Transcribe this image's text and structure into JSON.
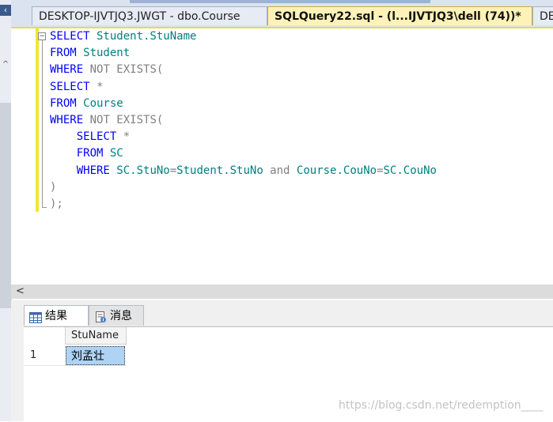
{
  "tabs": [
    {
      "label": "DESKTOP-IJVTJQ3.JWGT - dbo.Course"
    },
    {
      "label": "SQLQuery22.sql - (l...IJVTJQ3\\dell (74))*"
    },
    {
      "label": "DESK"
    }
  ],
  "editor": {
    "lines": [
      {
        "indent": "",
        "tokens": [
          {
            "t": "SELECT",
            "c": "kw"
          },
          {
            "t": " Student.StuName",
            "c": "id"
          }
        ]
      },
      {
        "indent": "",
        "tokens": [
          {
            "t": "FROM",
            "c": "kw"
          },
          {
            "t": " Student",
            "c": "id"
          }
        ]
      },
      {
        "indent": "",
        "tokens": [
          {
            "t": "WHERE",
            "c": "kw"
          },
          {
            "t": " NOT EXISTS(",
            "c": "op"
          }
        ]
      },
      {
        "indent": "",
        "tokens": [
          {
            "t": "SELECT",
            "c": "kw"
          },
          {
            "t": " *",
            "c": "op"
          }
        ]
      },
      {
        "indent": "",
        "tokens": [
          {
            "t": "FROM",
            "c": "kw"
          },
          {
            "t": " Course",
            "c": "id"
          }
        ]
      },
      {
        "indent": "",
        "tokens": [
          {
            "t": "WHERE",
            "c": "kw"
          },
          {
            "t": " NOT EXISTS(",
            "c": "op"
          }
        ]
      },
      {
        "indent": "    ",
        "tokens": [
          {
            "t": "SELECT",
            "c": "kw"
          },
          {
            "t": " *",
            "c": "op"
          }
        ]
      },
      {
        "indent": "    ",
        "tokens": [
          {
            "t": "FROM",
            "c": "kw"
          },
          {
            "t": " SC",
            "c": "id"
          }
        ]
      },
      {
        "indent": "    ",
        "tokens": [
          {
            "t": "WHERE",
            "c": "kw"
          },
          {
            "t": " SC.StuNo",
            "c": "id"
          },
          {
            "t": "=",
            "c": "op"
          },
          {
            "t": "Student.StuNo",
            "c": "id"
          },
          {
            "t": " and ",
            "c": "op"
          },
          {
            "t": "Course.CouNo",
            "c": "id"
          },
          {
            "t": "=",
            "c": "op"
          },
          {
            "t": "SC.CouNo",
            "c": "id"
          }
        ]
      },
      {
        "indent": "",
        "tokens": [
          {
            "t": ")",
            "c": "op"
          }
        ]
      },
      {
        "indent": "",
        "tokens": [
          {
            "t": ");",
            "c": "op"
          }
        ]
      }
    ]
  },
  "results": {
    "tabs": [
      {
        "label": "结果",
        "icon": "grid-icon"
      },
      {
        "label": "消息",
        "icon": "message-icon"
      }
    ],
    "columns": [
      "StuName"
    ],
    "rows": [
      {
        "num": "1",
        "cells": [
          "刘孟壮"
        ]
      }
    ]
  },
  "watermark": "https://blog.csdn.net/redemption____",
  "colors": {
    "keyword": "#0000ff",
    "identifier": "#008080",
    "operator": "#808080",
    "active_tab": "#fff2b8",
    "selected_cell": "#aed3f4"
  }
}
